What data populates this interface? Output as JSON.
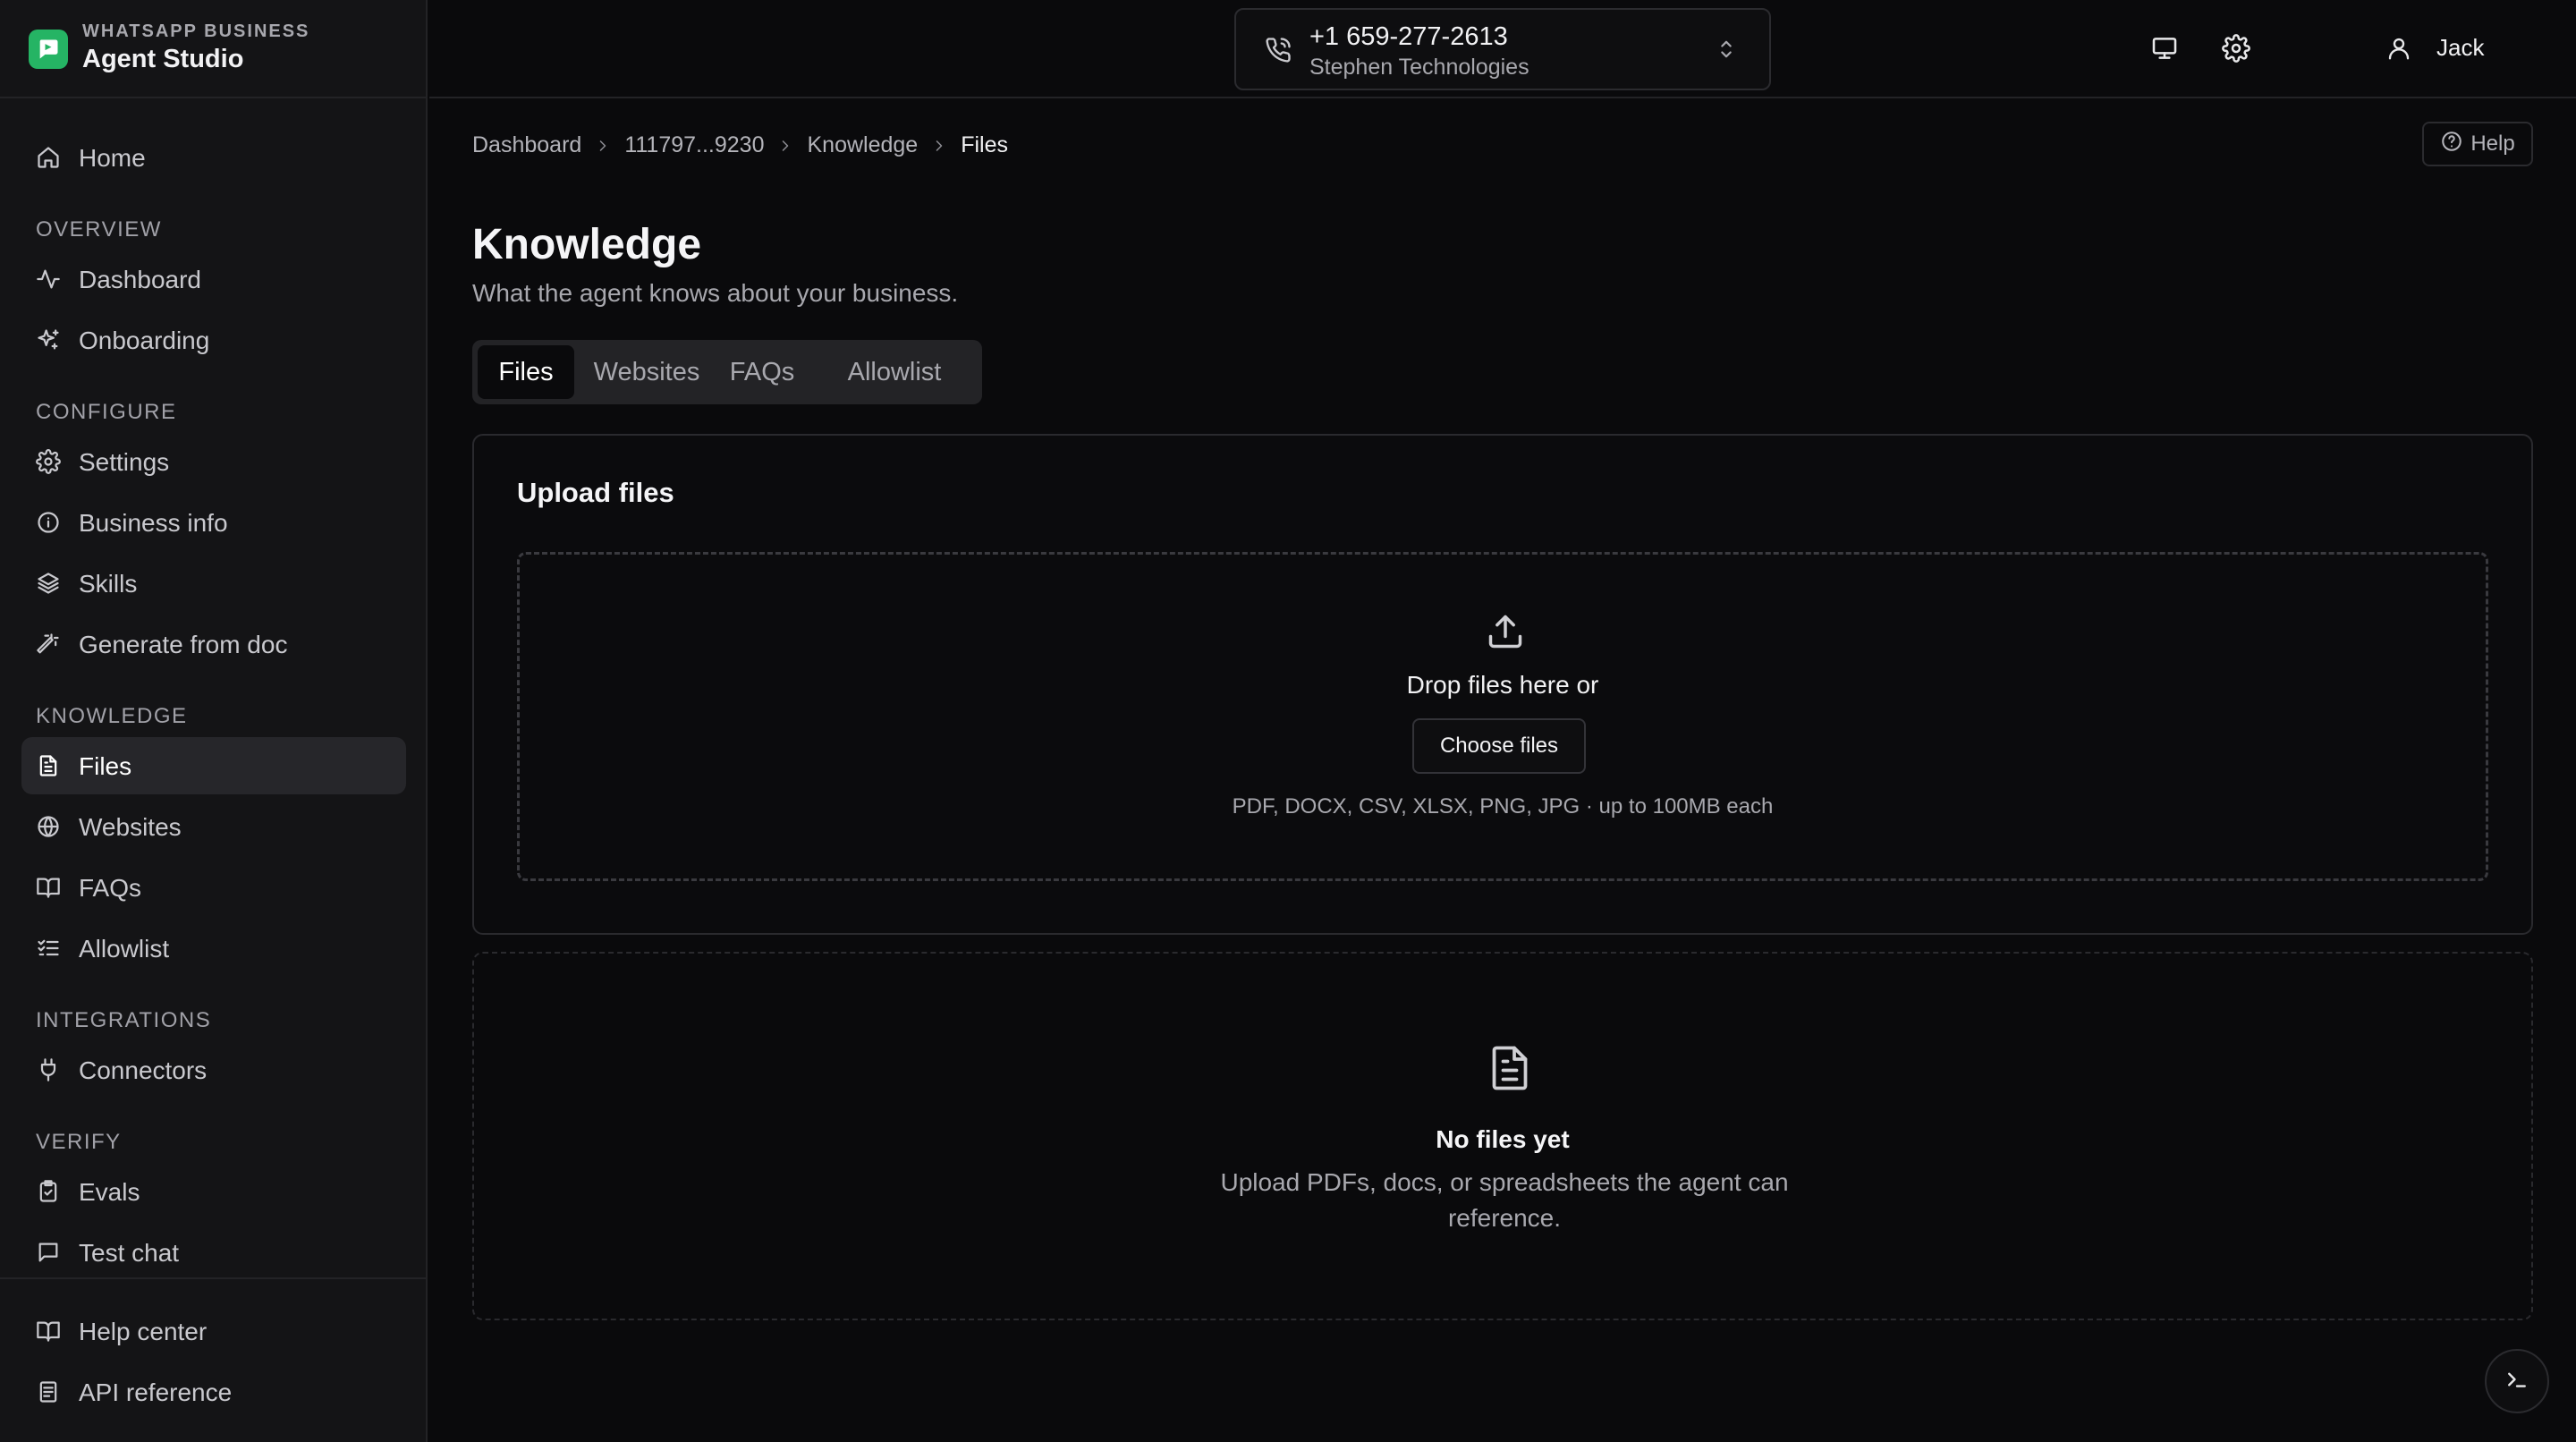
{
  "brand": {
    "small": "WHATSAPP BUSINESS",
    "title": "Agent Studio",
    "accent": "#25b464"
  },
  "sidebar": {
    "home": {
      "label": "Home",
      "icon": "home-icon"
    },
    "sections": [
      {
        "label": "OVERVIEW",
        "items": [
          {
            "label": "Dashboard",
            "icon": "activity-icon"
          },
          {
            "label": "Onboarding",
            "icon": "sparkles-icon"
          }
        ]
      },
      {
        "label": "CONFIGURE",
        "items": [
          {
            "label": "Settings",
            "icon": "gear-icon"
          },
          {
            "label": "Business info",
            "icon": "info-icon"
          },
          {
            "label": "Skills",
            "icon": "layers-icon"
          },
          {
            "label": "Generate from doc",
            "icon": "wand-icon"
          }
        ]
      },
      {
        "label": "KNOWLEDGE",
        "items": [
          {
            "label": "Files",
            "icon": "file-icon",
            "active": true
          },
          {
            "label": "Websites",
            "icon": "globe-icon"
          },
          {
            "label": "FAQs",
            "icon": "book-icon"
          },
          {
            "label": "Allowlist",
            "icon": "list-check-icon"
          }
        ]
      },
      {
        "label": "INTEGRATIONS",
        "items": [
          {
            "label": "Connectors",
            "icon": "plug-icon"
          }
        ]
      },
      {
        "label": "VERIFY",
        "items": [
          {
            "label": "Evals",
            "icon": "clipboard-check-icon"
          },
          {
            "label": "Test chat",
            "icon": "chat-icon"
          }
        ]
      }
    ],
    "footer": [
      {
        "label": "Help center",
        "icon": "book-icon"
      },
      {
        "label": "API reference",
        "icon": "document-icon"
      }
    ]
  },
  "topbar": {
    "phone_number": "+1 659-277-2613",
    "company": "Stephen Technologies",
    "user_name": "Jack"
  },
  "breadcrumb": [
    "Dashboard",
    "111797...9230",
    "Knowledge",
    "Files"
  ],
  "help_label": "Help",
  "page": {
    "title": "Knowledge",
    "subtitle": "What the agent knows about your business."
  },
  "tabs": [
    {
      "label": "Files",
      "active": true
    },
    {
      "label": "Websites"
    },
    {
      "label": "FAQs"
    },
    {
      "label": "Allowlist"
    }
  ],
  "upload": {
    "title": "Upload files",
    "drop_text": "Drop files here or",
    "button": "Choose files",
    "formats": "PDF, DOCX, CSV, XLSX, PNG, JPG · up to 100MB each"
  },
  "empty": {
    "title": "No files yet",
    "description": "Upload PDFs, docs, or spreadsheets the agent can reference."
  }
}
